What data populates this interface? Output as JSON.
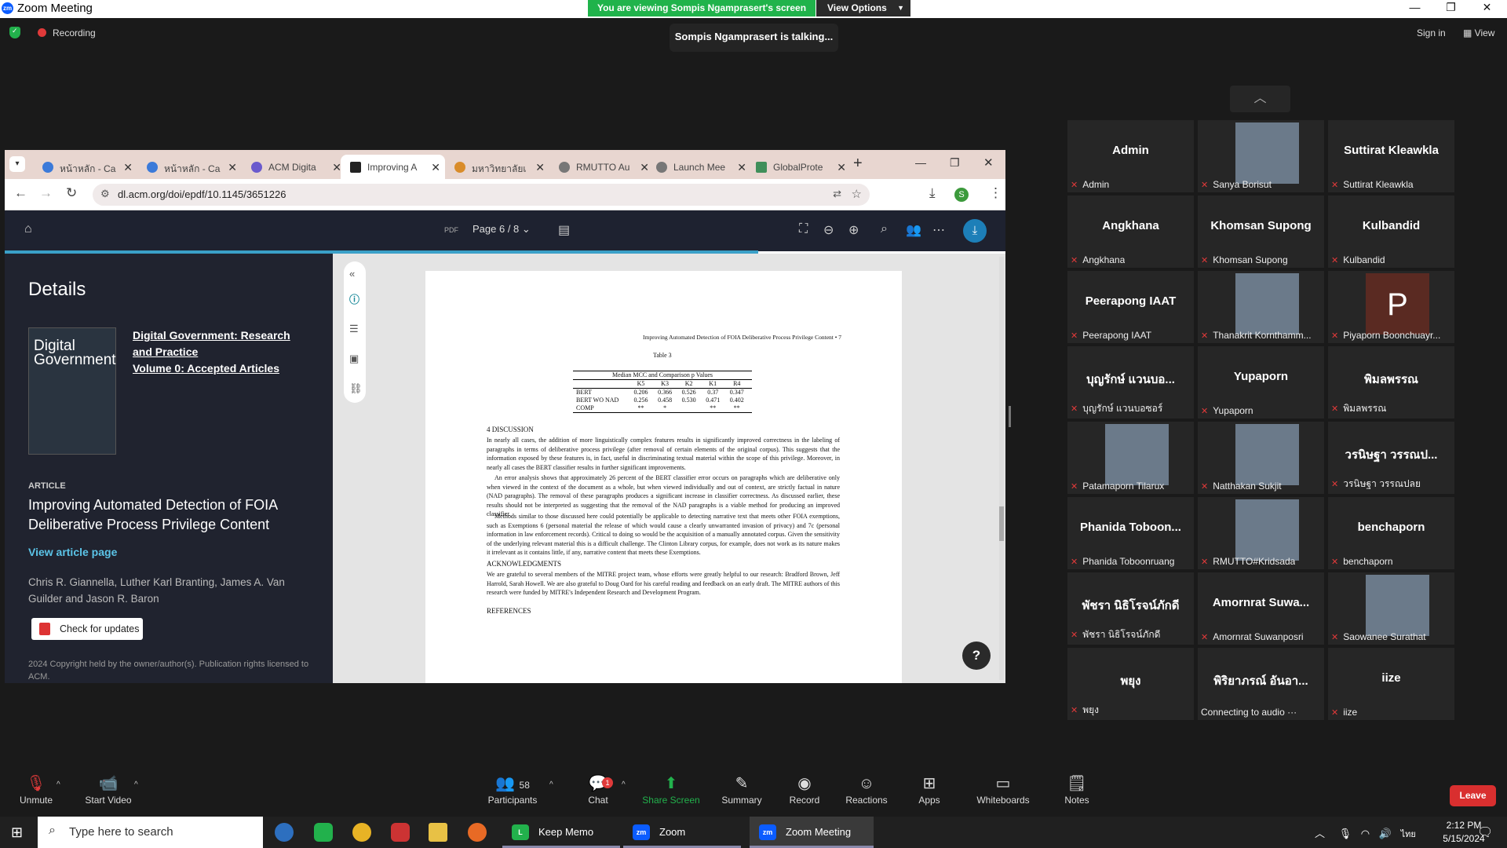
{
  "window": {
    "title": "Zoom Meeting"
  },
  "banner": {
    "viewing": "You are viewing Sompis Ngamprasert's screen",
    "view_options": "View Options"
  },
  "status": {
    "recording": "Recording",
    "talking": "Sompis Ngamprasert is talking...",
    "sign_in": "Sign in",
    "view": "View"
  },
  "browser": {
    "tabs": [
      "หน้าหลัก - Ca",
      "หน้าหลัก - Ca",
      "ACM Digita",
      "Improving A",
      "มหาวิทยาลัยเ",
      "RMUTTO Au",
      "Launch Mee",
      "GlobalProte"
    ],
    "active_tab": 3,
    "url": "dl.acm.org/doi/epdf/10.1145/3651226",
    "profile": "S"
  },
  "pdf_viewer": {
    "pdf_label": "PDF",
    "page_selector": "Page 6 / 8",
    "help": "?"
  },
  "details": {
    "heading": "Details",
    "cover_text": "Digital Government",
    "journal_line1": "Digital Government: Research and Practice",
    "journal_line2": "Volume 0: Accepted Articles",
    "article_label": "ARTICLE",
    "article_title": "Improving Automated Detection of FOIA Deliberative Process Privilege Content",
    "view_article": "View article page",
    "authors": "Chris R. Giannella, Luther Karl Branting, James A. Van Guilder and Jason R. Baron",
    "check_updates": "Check for updates",
    "copyright": "2024 Copyright held by the owner/author(s). Publication rights licensed to ACM."
  },
  "paper": {
    "running_head": "Improving Automated Detection of FOIA Deliberative Process Privilege Content  •  7",
    "table_title": "Table 3",
    "table_caption": "Median MCC and Comparison p Values",
    "table_columns": [
      "",
      "K5",
      "K3",
      "K2",
      "K1",
      "R4"
    ],
    "table_rows": [
      [
        "BERT",
        "0.206",
        "0.366",
        "0.526",
        "0.37",
        "0.347"
      ],
      [
        "BERT WO NAD",
        "0.256",
        "0.458",
        "0.530",
        "0.471",
        "0.402"
      ],
      [
        "COMP",
        "**",
        "*",
        "",
        "**",
        "**"
      ]
    ],
    "section_discussion": "4   DISCUSSION",
    "para1": "In nearly all cases, the addition of more linguistically complex features results in significantly improved correctness in the labeling of paragraphs in terms of deliberative process privilege (after removal of certain elements of the original corpus). This suggests that the information exposed by these features is, in fact, useful in discriminating textual material within the scope of this privilege. Moreover, in nearly all cases the BERT classifier results in further significant improvements.",
    "para2": "An error analysis shows that approximately 26 percent of the BERT classifier error occurs on paragraphs which are deliberative only when viewed in the context of the document as a whole, but when viewed individually and out of context, are strictly factual in nature (NAD paragraphs). The removal of these paragraphs produces a significant increase in classifier correctness. As discussed earlier, these results should not be interpreted as suggesting that the removal of the NAD paragraphs is a viable method for producing an improved classifier.",
    "para3": "Methods similar to those discussed here could potentially be applicable to detecting narrative text that meets other FOIA exemptions, such as Exemptions 6 (personal material the release of which would cause a clearly unwarranted invasion of privacy) and 7c (personal information in law enforcement records). Critical to doing so would be the acquisition of a manually annotated corpus. Given the sensitivity of the underlying relevant material this is a difficult challenge. The Clinton Library corpus, for example, does not work as its nature makes it irrelevant as it contains little, if any, narrative content that meets these Exemptions.",
    "section_ack": "ACKNOWLEDGMENTS",
    "para4": "We are grateful to several members of the MITRE project team, whose efforts were greatly helpful to our research: Bradford Brown, Jeff Harrold, Sarah Howell. We are also grateful to Doug Oard for his careful reading and feedback on an early draft. The MITRE authors of this research were funded by MITRE's Independent Research and Development Program.",
    "section_refs": "REFERENCES"
  },
  "participants": [
    {
      "name": "Admin",
      "label": "Admin",
      "video": false
    },
    {
      "name": "",
      "label": "Sanya Borisut",
      "video": true
    },
    {
      "name": "Suttirat Kleawkla",
      "label": "Suttirat Kleawkla",
      "video": false
    },
    {
      "name": "Angkhana",
      "label": "Angkhana",
      "video": false
    },
    {
      "name": "Khomsan Supong",
      "label": "Khomsan Supong",
      "video": false
    },
    {
      "name": "Kulbandid",
      "label": "Kulbandid",
      "video": false
    },
    {
      "name": "Peerapong IAAT",
      "label": "Peerapong IAAT",
      "video": false
    },
    {
      "name": "",
      "label": "Thanakrit Kornthamm...",
      "video": true
    },
    {
      "name": "",
      "label": "Piyaporn Boonchuayr...",
      "avatar": "P"
    },
    {
      "name": "บุญรักษ์ แวนบอ...",
      "label": "บุญรักษ์ แวนบอซอร์",
      "video": false
    },
    {
      "name": "Yupaporn",
      "label": "Yupaporn",
      "video": false
    },
    {
      "name": "พิมลพรรณ",
      "label": "พิมลพรรณ",
      "video": false
    },
    {
      "name": "",
      "label": "Patamaporn Tilarux",
      "video": true
    },
    {
      "name": "",
      "label": "Natthakan Sukjit",
      "video": true
    },
    {
      "name": "วรนิษฐา วรรณป...",
      "label": "วรนิษฐา วรรณปลย",
      "video": false
    },
    {
      "name": "Phanida Toboon...",
      "label": "Phanida Toboonruang",
      "video": false
    },
    {
      "name": "",
      "label": "RMUTTO#Kridsada",
      "video": true
    },
    {
      "name": "benchaporn",
      "label": "benchaporn",
      "video": false
    },
    {
      "name": "พัชรา นิธิโรจน์ภักดี",
      "label": "พัชรา นิธิโรจน์ภักดี",
      "video": false
    },
    {
      "name": "Amornrat Suwa...",
      "label": "Amornrat Suwanposri",
      "video": false
    },
    {
      "name": "",
      "label": "Saowanee Surathat",
      "video": true
    },
    {
      "name": "พยุง",
      "label": "พยุง",
      "video": false
    },
    {
      "name": "พิริยาภรณ์ อันอา...",
      "label": "Connecting to audio ···",
      "video": false,
      "nomic": true
    },
    {
      "name": "iize",
      "label": "iize",
      "video": false
    }
  ],
  "toolbar": {
    "unmute": "Unmute",
    "start_video": "Start Video",
    "participants": "Participants",
    "participant_count": "58",
    "chat": "Chat",
    "chat_badge": "1",
    "share": "Share Screen",
    "summary": "Summary",
    "record": "Record",
    "reactions": "Reactions",
    "apps": "Apps",
    "whiteboards": "Whiteboards",
    "notes": "Notes",
    "leave": "Leave"
  },
  "taskbar": {
    "search_placeholder": "Type here to search",
    "keep_memo": "Keep Memo",
    "zoom": "Zoom",
    "zoom_meeting": "Zoom Meeting",
    "time": "2:12 PM",
    "date": "5/15/2024",
    "lang": "ไทย"
  },
  "colors": {
    "share_green": "#22b14c",
    "leave_red": "#d92f2f",
    "accent_blue": "#3aa0c8"
  }
}
